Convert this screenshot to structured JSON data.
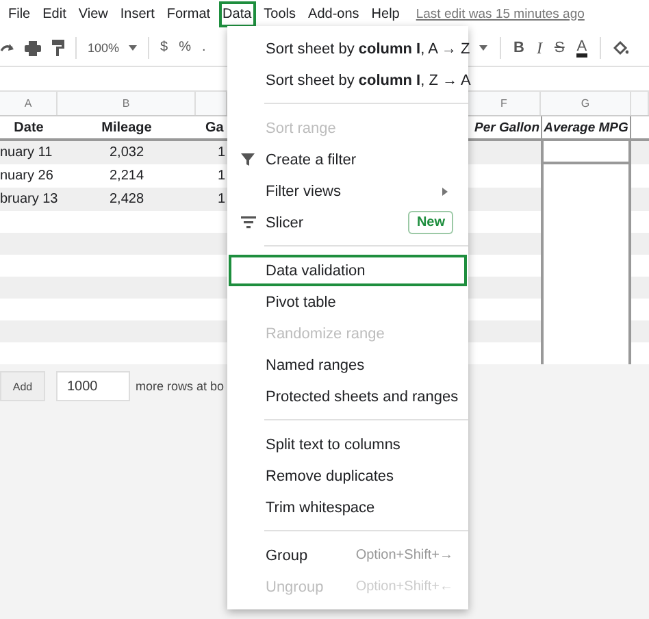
{
  "menubar": {
    "items": [
      {
        "label": "File",
        "selected": false
      },
      {
        "label": "Edit",
        "selected": false
      },
      {
        "label": "View",
        "selected": false
      },
      {
        "label": "Insert",
        "selected": false
      },
      {
        "label": "Format",
        "selected": false
      },
      {
        "label": "Data",
        "selected": true
      },
      {
        "label": "Tools",
        "selected": false
      },
      {
        "label": "Add-ons",
        "selected": false
      },
      {
        "label": "Help",
        "selected": false
      }
    ],
    "last_edit": "Last edit was 15 minutes ago"
  },
  "toolbar": {
    "zoom": "100%",
    "currency": "$",
    "percent": "%",
    "decimal": ".",
    "bold": "B",
    "italic": "I",
    "strikethrough": "S",
    "text_color": "A"
  },
  "sheet": {
    "columns": [
      "A",
      "B",
      null,
      "F",
      "G",
      null
    ],
    "rows": [
      [
        "Date",
        "Mileage",
        "Ga",
        "Per Gallon",
        "Average MPG",
        null
      ],
      [
        "nuary 11",
        "2,032",
        "1",
        null,
        null,
        null
      ],
      [
        "nuary 26",
        "2,214",
        "1",
        null,
        null,
        null
      ],
      [
        "bruary 13",
        "2,428",
        "1",
        null,
        null,
        null
      ]
    ],
    "add_rows": {
      "button": "Add",
      "value": "1000",
      "text": "more rows at bo"
    }
  },
  "data_menu": {
    "items": [
      {
        "kind": "item",
        "label": "Sort sheet by **column I**, A → Z",
        "disabled": false,
        "selected": false
      },
      {
        "kind": "item",
        "label": "Sort sheet by **column I**, Z → A",
        "disabled": false,
        "selected": false
      },
      {
        "kind": "separator"
      },
      {
        "kind": "item",
        "label": "Sort range",
        "disabled": true,
        "selected": false
      },
      {
        "kind": "filter",
        "label": "Create a filter",
        "disabled": false,
        "selected": false
      },
      {
        "kind": "item",
        "label": "Filter views",
        "submenu": true,
        "disabled": false,
        "selected": false
      },
      {
        "kind": "slicer",
        "label": "Slicer",
        "badge": "New",
        "disabled": false,
        "selected": false
      },
      {
        "kind": "separator"
      },
      {
        "kind": "item",
        "label": "Data validation",
        "disabled": false,
        "selected": true
      },
      {
        "kind": "item",
        "label": "Pivot table",
        "disabled": false,
        "selected": false
      },
      {
        "kind": "item",
        "label": "Randomize range",
        "disabled": true,
        "selected": false
      },
      {
        "kind": "item",
        "label": "Named ranges",
        "disabled": false,
        "selected": false
      },
      {
        "kind": "item",
        "label": "Protected sheets and ranges",
        "disabled": false,
        "selected": false
      },
      {
        "kind": "separator"
      },
      {
        "kind": "item",
        "label": "Split text to columns",
        "disabled": false,
        "selected": false
      },
      {
        "kind": "item",
        "label": "Remove duplicates",
        "disabled": false,
        "selected": false
      },
      {
        "kind": "item",
        "label": "Trim whitespace",
        "disabled": false,
        "selected": false
      },
      {
        "kind": "separator"
      },
      {
        "kind": "item",
        "label": "Group",
        "shortcut": "Option+Shift+→",
        "disabled": false,
        "selected": false
      },
      {
        "kind": "item",
        "label": "Ungroup",
        "shortcut": "Option+Shift+←",
        "disabled": true,
        "selected": false
      }
    ]
  }
}
